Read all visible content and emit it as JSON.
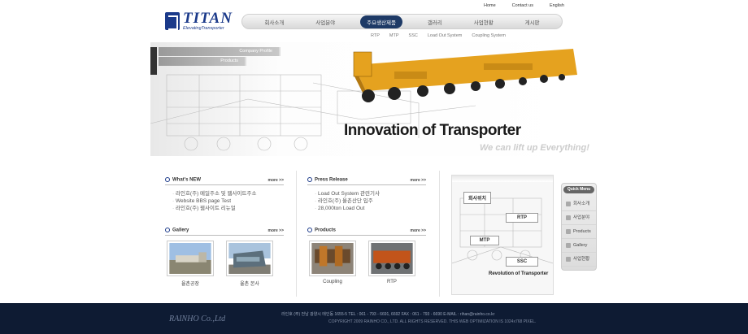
{
  "header": {
    "logo_name": "TITAN",
    "logo_tagline": "ElevatingTransporter",
    "util_links": [
      "Home",
      "Contact us",
      "English"
    ],
    "nav": [
      "회사소개",
      "사업분야",
      "주요생산제품",
      "갤러리",
      "사업현황",
      "게시판"
    ],
    "nav_active_index": 2,
    "subnav": [
      "RTP",
      "MTP",
      "SSC",
      "Load Out System",
      "Coupling System"
    ]
  },
  "visual": {
    "lnb": [
      "Company Profile",
      "Products"
    ],
    "slogan": "Innovation of Transporter",
    "sub_slogan": "We can lift up Everything!"
  },
  "whats_new": {
    "title": "What's NEW",
    "more": "more >>",
    "items": [
      "라인호(주) 메일주소 및 웹사이트주소",
      "Website BBS page Test",
      "라인호(주) 웹사이트 리뉴얼"
    ]
  },
  "press": {
    "title": "Press Release",
    "more": "more >>",
    "items": [
      "Load Out System 관련기사",
      "라인호(주) 울촌산단 입주",
      "28,000ton Load Out"
    ]
  },
  "gallery": {
    "title": "Gallery",
    "more": "more >>",
    "captions": [
      "율촌공장",
      "율촌 본사"
    ]
  },
  "products": {
    "title": "Products",
    "more": "more >>",
    "captions": [
      "Coupling",
      "RTP"
    ]
  },
  "mapbox": {
    "labels": [
      "회사위치",
      "RTP",
      "MTP",
      "SSC"
    ],
    "revolution": "Revolution of Transporter"
  },
  "quick": {
    "title": "Quick Menu",
    "items": [
      "회사소개",
      "사업분야",
      "Products",
      "Gallery",
      "사업현황"
    ]
  },
  "footer": {
    "company": "RAINHO Co.,Ltd",
    "line1": "라인호 (주)   전남 광양시 태인동 1655-5    TEL :  061 - 793 - 6691, 6692      FAX :  061 - 793 - 6690    E-MAIL :  rihan@rainho.co.kr",
    "line2": "COPYRIGHT 2009 RAINHO CO., LTD. ALL RIGHTS RESERVED.       THIS WEB OPTIMIZATION IS 1024x768 PIXEL."
  },
  "colors": {
    "brand": "#1b3a8a",
    "active_nav": "#1e3a66",
    "footer": "#0e1b33",
    "machine": "#e5a21f"
  }
}
